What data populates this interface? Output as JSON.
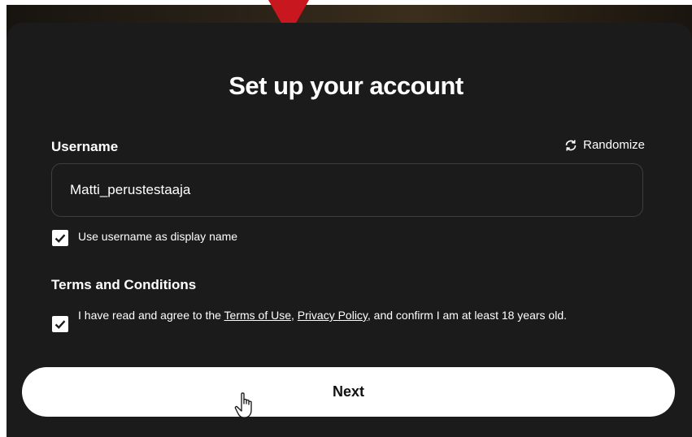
{
  "dialog": {
    "title": "Set up your account"
  },
  "username": {
    "label": "Username",
    "value": "Matti_perustestaaja",
    "randomize_label": "Randomize"
  },
  "display_name_option": {
    "label": "Use username as display name",
    "checked": true
  },
  "terms": {
    "heading": "Terms and Conditions",
    "checked": true,
    "text_before": "I have read and agree to the ",
    "terms_link": "Terms of Use",
    "separator": ", ",
    "privacy_link": "Privacy Policy",
    "text_after": ", and confirm I am at least 18 years old."
  },
  "next_button": {
    "label": "Next"
  },
  "icons": {
    "randomize": "refresh-icon",
    "checkbox": "checkmark-icon",
    "pointer": "hand-pointer-cursor-icon"
  },
  "colors": {
    "card_background": "#1b1b1b",
    "accent_red": "#c8171e",
    "text": "#ffffff",
    "button_background": "#ffffff"
  }
}
